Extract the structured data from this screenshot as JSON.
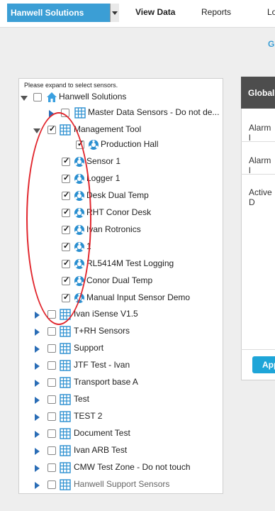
{
  "header": {
    "site_select": "Hanwell Solutions",
    "nav": [
      "View Data",
      "Reports",
      "Lo"
    ]
  },
  "top_link": "G",
  "tree": {
    "hint": "Please expand to select sensors.",
    "root": "Hanwell Solutions",
    "items": [
      {
        "label": "Master Data Sensors - Do not de..."
      },
      {
        "label": "Management Tool"
      },
      {
        "label": "Production Hall"
      },
      {
        "label": "Sensor 1"
      },
      {
        "label": "Logger 1"
      },
      {
        "label": "Desk Dual Temp"
      },
      {
        "label": "RHT Conor Desk"
      },
      {
        "label": "Ivan Rotronics"
      },
      {
        "label": "1"
      },
      {
        "label": "RL5414M Test Logging"
      },
      {
        "label": "Conor Dual Temp"
      },
      {
        "label": "Manual Input Sensor Demo"
      },
      {
        "label": "Ivan iSense V1.5"
      },
      {
        "label": "T+RH Sensors"
      },
      {
        "label": "Support"
      },
      {
        "label": "JTF Test - Ivan"
      },
      {
        "label": "Transport base A"
      },
      {
        "label": "Test"
      },
      {
        "label": "TEST 2"
      },
      {
        "label": "Document Test"
      },
      {
        "label": "Ivan ARB Test"
      },
      {
        "label": "CMW Test Zone - Do not touch"
      },
      {
        "label": "Hanwell Support Sensors"
      }
    ]
  },
  "global_panel": {
    "title": "Global",
    "rows": [
      "Alarm l",
      "Alarm l",
      "Active D"
    ],
    "apply": "App"
  },
  "colors": {
    "accent": "#3b9ed5",
    "expander": "#2a6db6",
    "annotation": "#e1262d",
    "panel_header": "#4d4d4d",
    "apply_button": "#1ea5d8"
  }
}
